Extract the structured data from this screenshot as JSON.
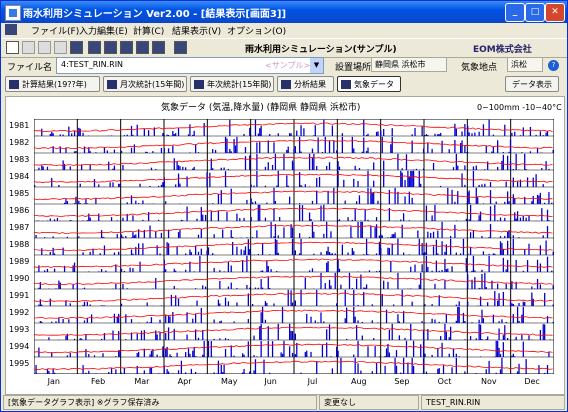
{
  "window": {
    "title": "雨水利用シミュレーション Ver2.00 - [結果表示[画面3]]"
  },
  "menu": [
    "ファイル(F)",
    "入力編集(E)",
    "計算(C)",
    "結果表示(V)",
    "オプション(O)"
  ],
  "toolbar": {
    "app_name": "雨水利用シミュレーション(サンプル)",
    "company": "EOM株式会社"
  },
  "file": {
    "label": "ファイル名",
    "value": "4:TEST_RIN.RIN",
    "sample": "<サンプル>"
  },
  "location": {
    "label": "設置場所",
    "value": "静岡県 浜松市",
    "point_label": "気象地点",
    "point_value": "浜松"
  },
  "buttons": {
    "calc_results": "計算結果(19??年)",
    "monthly": "月次統計(15年間)",
    "yearly": "年次統計(15年間)",
    "analysis": "分析結果",
    "weather": "気象データ",
    "data_display": "データ表示"
  },
  "chart": {
    "title": "気象データ (気温,降水量) (静岡県 静岡県 浜松市)",
    "range_note": "0~100mm -10~40°C"
  },
  "chart_data": {
    "type": "line",
    "title": "気象データ (気温,降水量) (静岡県 静岡県 浜松市)",
    "years": [
      "1981",
      "1982",
      "1983",
      "1984",
      "1985",
      "1986",
      "1987",
      "1988",
      "1989",
      "1990",
      "1991",
      "1992",
      "1993",
      "1994",
      "1995"
    ],
    "months": [
      "Jan",
      "Feb",
      "Mar",
      "Apr",
      "May",
      "Jun",
      "Jul",
      "Aug",
      "Sep",
      "Oct",
      "Nov",
      "Dec"
    ],
    "series": [
      {
        "name": "気温",
        "color": "#ff0000"
      },
      {
        "name": "降水量",
        "color": "#0000cc"
      }
    ],
    "ylim_precip_mm": [
      0,
      100
    ],
    "ylim_temp_c": [
      -10,
      40
    ],
    "grid": true
  },
  "status": {
    "left": "[気象データグラフ表示] ※グラフ保存済み",
    "middle": "変更なし",
    "right": "TEST_RIN.RIN"
  },
  "colors": {
    "temp": "#ff0000",
    "precip": "#0000cc",
    "titlebar": "#0054e3"
  }
}
